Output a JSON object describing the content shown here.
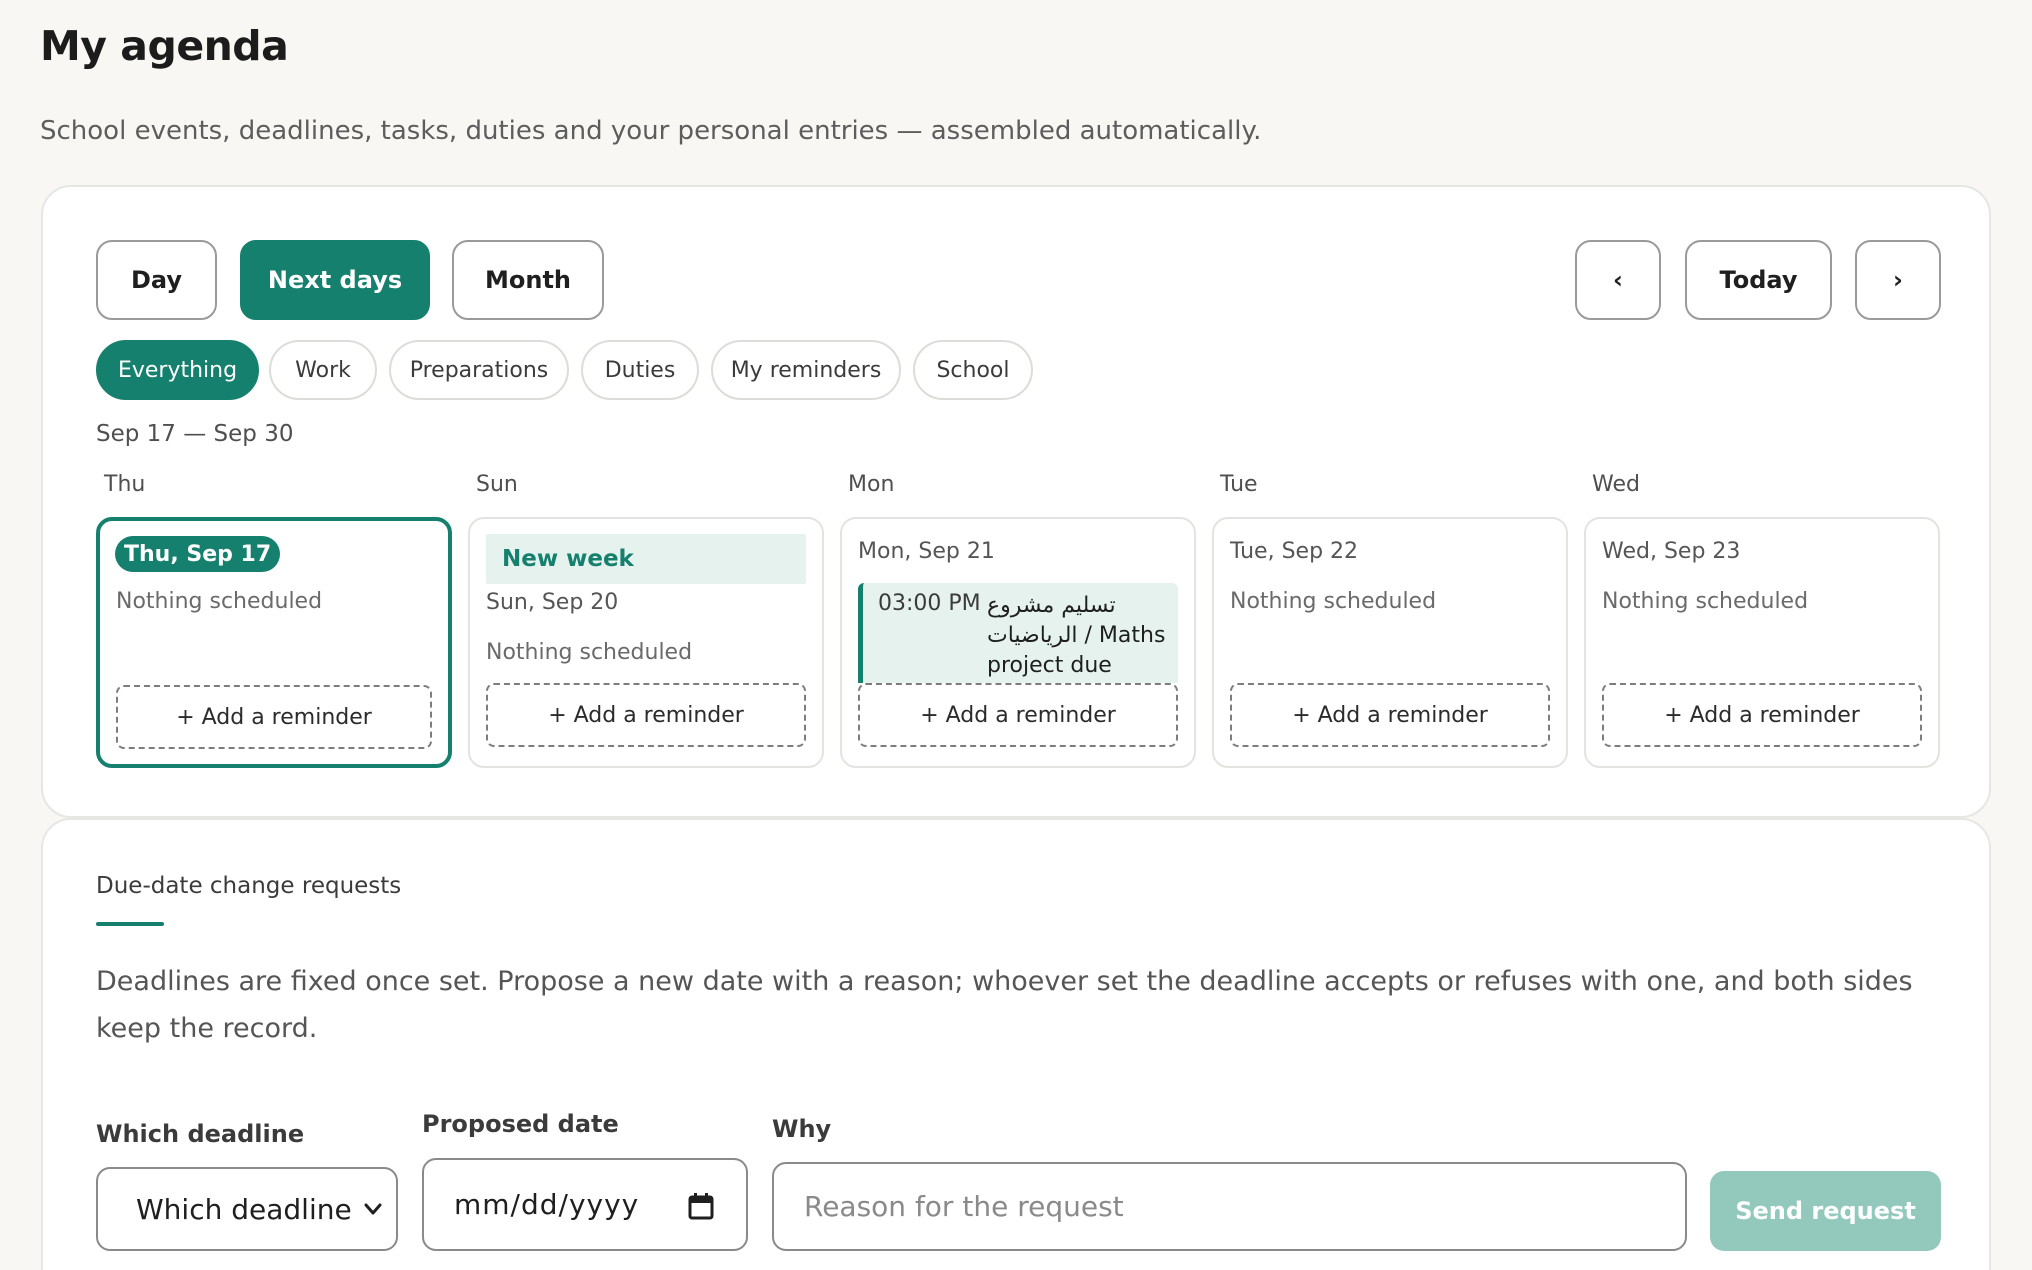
{
  "header": {
    "title": "My agenda",
    "subtitle": "School events, deadlines, tasks, duties and your personal entries — assembled automatically."
  },
  "views": [
    {
      "label": "Day",
      "active": false
    },
    {
      "label": "Next days",
      "active": true
    },
    {
      "label": "Month",
      "active": false
    }
  ],
  "nav": {
    "prev": "‹",
    "today": "Today",
    "next": "›"
  },
  "filters": [
    {
      "label": "Everything",
      "active": true
    },
    {
      "label": "Work",
      "active": false
    },
    {
      "label": "Preparations",
      "active": false
    },
    {
      "label": "Duties",
      "active": false
    },
    {
      "label": "My reminders",
      "active": false
    },
    {
      "label": "School",
      "active": false
    }
  ],
  "range": "Sep 17 — Sep 30",
  "days": [
    {
      "weekday": "Thu",
      "date": "Thu, Sep 17",
      "today": true,
      "empty": "Nothing scheduled",
      "add": "+ Add a reminder"
    },
    {
      "weekday": "Sun",
      "banner": "New week",
      "date": "Sun, Sep 20",
      "empty": "Nothing scheduled",
      "add": "+ Add a reminder"
    },
    {
      "weekday": "Mon",
      "date": "Mon, Sep 21",
      "event": {
        "time": "03:00 PM",
        "title": "تسليم مشروع الرياضيات / Maths project due"
      },
      "add": "+ Add a reminder"
    },
    {
      "weekday": "Tue",
      "date": "Tue, Sep 22",
      "empty": "Nothing scheduled",
      "add": "+ Add a reminder"
    },
    {
      "weekday": "Wed",
      "date": "Wed, Sep 23",
      "empty": "Nothing scheduled",
      "add": "+ Add a reminder"
    }
  ],
  "requests": {
    "title": "Due-date change requests",
    "description": "Deadlines are fixed once set. Propose a new date with a reason; whoever set the deadline accepts or refuses with one, and both sides keep the record.",
    "deadline_label": "Which deadline",
    "deadline_value": "Which deadline",
    "date_label": "Proposed date",
    "date_placeholder": "mm/dd/yyyy",
    "why_label": "Why",
    "why_placeholder": "Reason for the request",
    "send": "Send request"
  },
  "colors": {
    "accent": "#16806e",
    "accent_light": "#e5f2ee",
    "send_disabled": "#93c9bd"
  },
  "icons": {
    "select_chevron": "chevron-down-icon",
    "date_picker": "calendar-icon"
  }
}
